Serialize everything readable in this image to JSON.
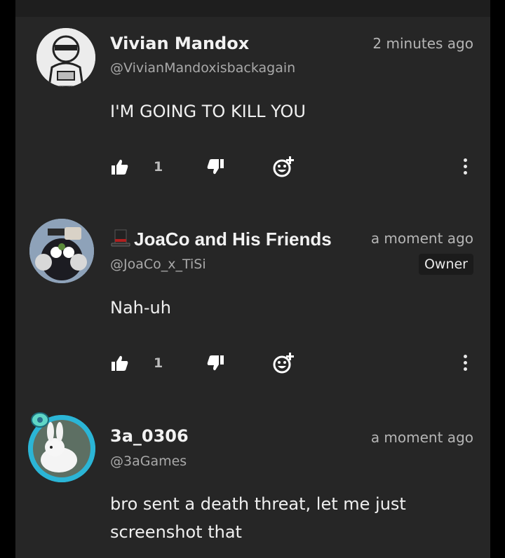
{
  "comments": [
    {
      "name": "Vivian Mandox",
      "handle": "@VivianMandoxisbackagain",
      "time": "2 minutes ago",
      "text": "I'M GOING TO KILL YOU",
      "likes": "1",
      "avatar": "vivian-avatar"
    },
    {
      "name": "JoaCo and His Friends",
      "handle": "@JoaCo_x_TiSi",
      "time": "a moment ago",
      "badge": "Owner",
      "text": "Nah-uh",
      "likes": "1",
      "avatar": "joaco-avatar"
    },
    {
      "name": "3a_0306",
      "handle": "@3aGames",
      "time": "a moment ago",
      "text": "bro sent a death threat, let me just screenshot that",
      "avatar": "rabbit-avatar"
    }
  ],
  "icons": {
    "like": "thumbs-up-icon",
    "dislike": "thumbs-down-icon",
    "react": "add-reaction-icon",
    "more": "more-vertical-icon"
  },
  "colors": {
    "background": "#262626",
    "text": "#f0f0f0",
    "muted": "#a9a9a9",
    "ring": "#2bb5d6"
  }
}
